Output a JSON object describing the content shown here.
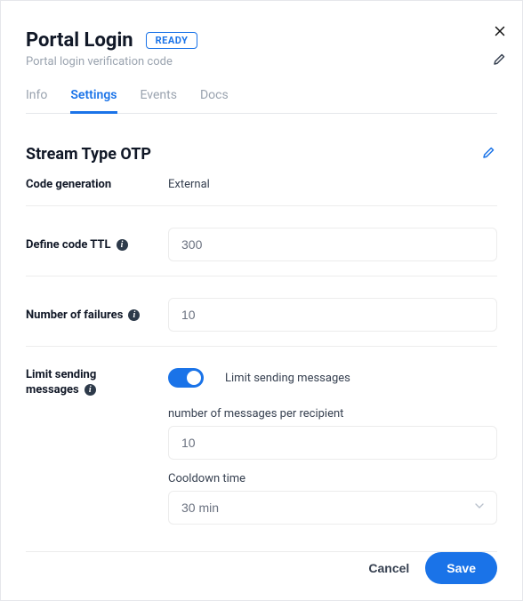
{
  "header": {
    "title": "Portal Login",
    "badge": "READY",
    "subtitle": "Portal login verification code"
  },
  "tabs": {
    "info": "Info",
    "settings": "Settings",
    "events": "Events",
    "docs": "Docs"
  },
  "section": {
    "title": "Stream Type OTP",
    "code_generation_label": "Code generation",
    "code_generation_value": "External",
    "ttl_label": "Define code TTL",
    "ttl_value": "300",
    "failures_label": "Number of failures",
    "failures_value": "10",
    "limit_label_line1": "Limit sending",
    "limit_label_line2": "messages",
    "limit_toggle_label": "Limit sending messages",
    "per_recipient_label": "number of messages per recipient",
    "per_recipient_value": "10",
    "cooldown_label": "Cooldown time",
    "cooldown_value": "30 min"
  },
  "actions": {
    "cancel": "Cancel",
    "save": "Save"
  }
}
